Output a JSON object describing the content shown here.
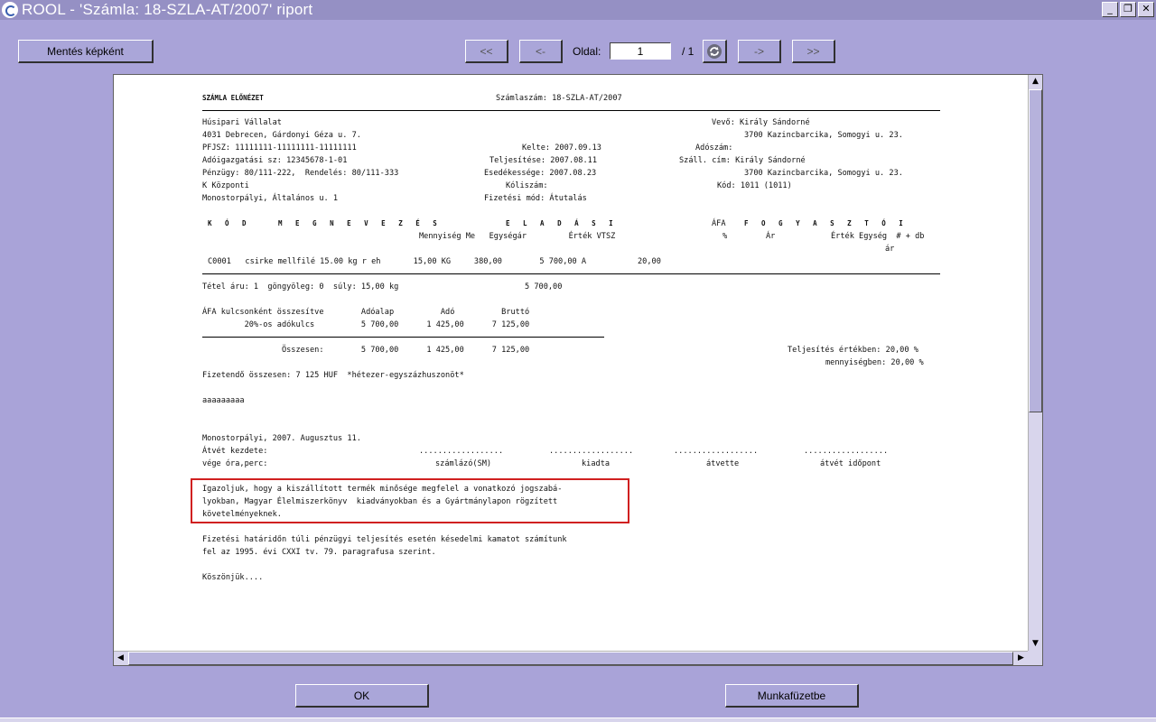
{
  "window": {
    "title": "ROOL  -  'Számla: 18-SZLA-AT/2007' riport",
    "controls": {
      "minimize": "_",
      "restore": "❐",
      "close": "✕"
    }
  },
  "toolbar": {
    "save_image_label": "Mentés képként",
    "first_label": "<<",
    "prev_label": "<-",
    "page_label": "Oldal:",
    "page_value": "1",
    "page_total": "/ 1",
    "next_label": "->",
    "last_label": ">>"
  },
  "footer": {
    "ok_label": "OK",
    "workbook_label": "Munkafüzetbe"
  },
  "report": {
    "title": "SZÁMLA ELŐNÉZET",
    "invoice_no": "Számlaszám: 18-SZLA-AT/2007",
    "seller": {
      "name": "Húsipari Vállalat",
      "address": "4031 Debrecen, Gárdonyi Géza u. 7.",
      "pfjsz": "PFJSZ: 11111111-11111111-11111111",
      "tax_id": "Adóigazgatási sz: 12345678-1-01",
      "finance": "Pénzügy: 80/111-222,  Rendelés: 80/111-333",
      "central": "K Központi",
      "site": "Monostorpályi, Általános u. 1"
    },
    "mid": {
      "issued": "Kelte: 2007.09.13",
      "performed": "Teljesítése: 2007.08.11",
      "due": "Esedékessége: 2007.08.23",
      "sender_no": "Kóliszám:",
      "payment": "Fizetési mód: Átutalás"
    },
    "buyer": {
      "buyer": "Vevő: Király Sándorné",
      "buyer_address": "3700 Kazincbarcika, Somogyi u. 23.",
      "tax_no": "Adószám:",
      "ship_addr": "Száll. cím: Király Sándorné",
      "ship_addr2": "3700 Kazincbarcika, Somogyi u. 23.",
      "code": "Kód: 1011 (1011)"
    },
    "table_header": {
      "kod": "K Ó D",
      "megnevezes": "M E G N E V E Z É S",
      "eladasi": "E L A D Á S I",
      "afa": "ÁFA",
      "fogyasztoi": "F O G Y A S Z T Ó I",
      "sub1": "Mennyiség Me   Egységár         Érték VTSZ",
      "sub_pct": "%",
      "sub_ar": "Ár",
      "sub2": "Érték Egység  # + db",
      "sub3": "ár"
    },
    "item_line": "C0001   csirke mellfilé 15.00 kg r eh       15,00 KG     380,00        5 700,00 A           20,00",
    "totals_line": "Tétel áru: 1  göngyöleg: 0  súly: 15,00 kg                           5 700,00",
    "vat_summary": {
      "header": "ÁFA kulcsonként összesítve        Adóalap          Adó          Bruttó",
      "row": "         20%-os adókulcs          5 700,00      1 425,00      7 125,00",
      "sum": "                 Összesen:        5 700,00      1 425,00      7 125,00"
    },
    "performance": {
      "value": "Teljesítés értékben: 20,00 %",
      "quantity": "mennyiségben: 20,00 %"
    },
    "payable": "Fizetendő összesen: 7 125 HUF  *hétezer-egyszázhuszonöt*",
    "aaa": "aaaaaaaaa",
    "place_date": "Monostorpályi, 2007. Augusztus 11.",
    "receive_start": "Átvét kezdete:",
    "receive_end": "vége óra,perc:",
    "dots": "..................",
    "sig_invoicer": "számlázó(SM)",
    "sig_issued": "kiadta",
    "sig_received": "átvette",
    "sig_time": "átvét időpont",
    "certificate": [
      "Igazoljuk, hogy a kiszállított termék minősége megfelel a vonatkozó jogszabá-",
      "lyokban, Magyar Élelmiszerkönyv  kiadványokban és a Gyártmánylapon rögzített",
      "követelményeknek."
    ],
    "late_payment": [
      "Fizetési határidőn túli pénzügyi teljesítés esetén késedelmi kamatot számítunk",
      "fel az 1995. évi CXXI tv. 79. paragrafusa szerint."
    ],
    "thanks": "Köszönjük...."
  }
}
